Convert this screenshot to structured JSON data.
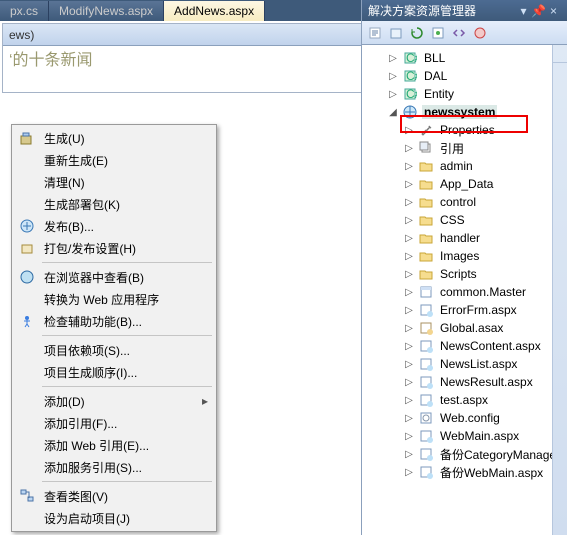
{
  "tabs": {
    "t0": "px.cs",
    "t1": "ModifyNews.aspx",
    "t2": "AddNews.aspx"
  },
  "editor": {
    "dropdown": "ews)",
    "placeholder_text": "‘的十条新闻"
  },
  "panel_title": "解决方案资源管理器",
  "ctx": {
    "build": "生成(U)",
    "rebuild": "重新生成(E)",
    "clean": "清理(N)",
    "build_deploy": "生成部署包(K)",
    "publish": "发布(B)...",
    "package": "打包/发布设置(H)",
    "view_browser": "在浏览器中查看(B)",
    "convert": "转换为 Web 应用程序",
    "accessibility": "检查辅助功能(B)...",
    "proj_deps": "项目依赖项(S)...",
    "build_order": "项目生成顺序(I)...",
    "add": "添加(D)",
    "add_ref": "添加引用(F)...",
    "add_web_ref": "添加 Web 引用(E)...",
    "add_svc_ref": "添加服务引用(S)...",
    "class_diagram": "查看类图(V)",
    "set_startup": "设为启动项目(J)"
  },
  "tree": {
    "bll": "BLL",
    "dal": "DAL",
    "entity": "Entity",
    "newssystem": "newssystem",
    "properties": "Properties",
    "references": "引用",
    "admin": "admin",
    "appdata": "App_Data",
    "control": "control",
    "css": "CSS",
    "handler": "handler",
    "images": "Images",
    "scripts": "Scripts",
    "common_master": "common.Master",
    "errorfrm": "ErrorFrm.aspx",
    "global": "Global.asax",
    "newscontent": "NewsContent.aspx",
    "newslist": "NewsList.aspx",
    "newsresult": "NewsResult.aspx",
    "test": "test.aspx",
    "webconfig": "Web.config",
    "webmain": "WebMain.aspx",
    "bak1": "备份CategoryManager",
    "bak2": "备份WebMain.aspx"
  }
}
